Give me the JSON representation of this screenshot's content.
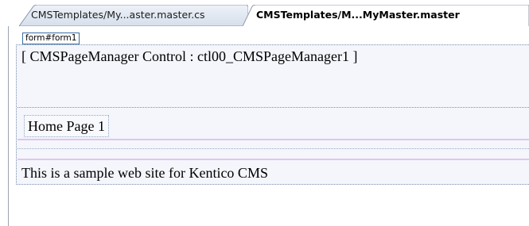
{
  "tabs": [
    {
      "label": "CMSTemplates/My...aster.master.cs",
      "active": false
    },
    {
      "label": "CMSTemplates/M...MyMaster.master",
      "active": true
    }
  ],
  "designer": {
    "form_tag": "form#form1",
    "page_manager_text": "[ CMSPageManager Control : ctl00_CMSPageManager1 ]",
    "page_title": "Home Page 1",
    "footer_text": "This is a sample web site for Kentico CMS"
  },
  "colors": {
    "tab_border": "#8c97a8",
    "active_tab_bg": "#ffffff",
    "inactive_tab_bg": "#dfe6f1",
    "region_border": "#7a8fb0",
    "placeholder_line": "#e2c4ee"
  }
}
